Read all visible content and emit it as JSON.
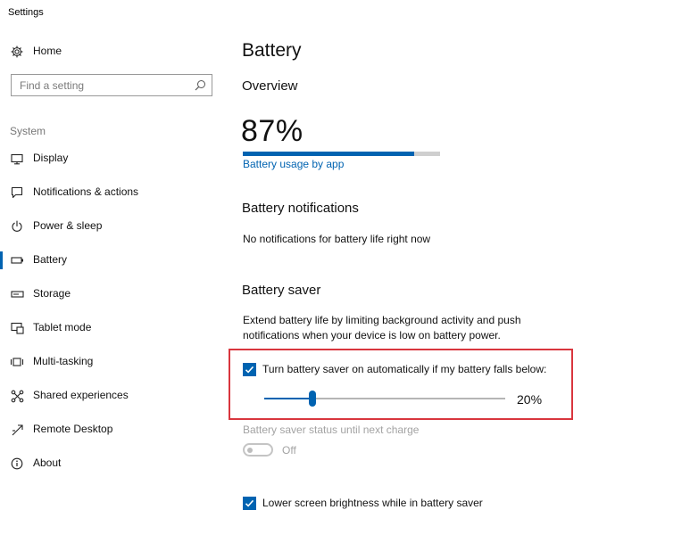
{
  "window": {
    "title": "Settings"
  },
  "sidebar": {
    "home_label": "Home",
    "search_placeholder": "Find a setting",
    "section_label": "System",
    "items": [
      {
        "label": "Display",
        "icon": "monitor-icon",
        "active": false
      },
      {
        "label": "Notifications & actions",
        "icon": "notification-icon",
        "active": false
      },
      {
        "label": "Power & sleep",
        "icon": "power-icon",
        "active": false
      },
      {
        "label": "Battery",
        "icon": "battery-icon",
        "active": true
      },
      {
        "label": "Storage",
        "icon": "storage-icon",
        "active": false
      },
      {
        "label": "Tablet mode",
        "icon": "tablet-mode-icon",
        "active": false
      },
      {
        "label": "Multi-tasking",
        "icon": "multitasking-icon",
        "active": false
      },
      {
        "label": "Shared experiences",
        "icon": "shared-experiences-icon",
        "active": false
      },
      {
        "label": "Remote Desktop",
        "icon": "remote-desktop-icon",
        "active": false
      },
      {
        "label": "About",
        "icon": "info-icon",
        "active": false
      }
    ]
  },
  "main": {
    "page_title": "Battery",
    "overview": {
      "heading": "Overview",
      "percent_text": "87%",
      "percent_value": 0.87,
      "usage_link": "Battery usage by app"
    },
    "notifications": {
      "heading": "Battery notifications",
      "text": "No notifications for battery life right now"
    },
    "saver": {
      "heading": "Battery saver",
      "description": "Extend battery life by limiting background activity and push notifications when your device is low on battery power.",
      "auto_checkbox_label": "Turn battery saver on automatically if my battery falls below:",
      "auto_checked": true,
      "threshold_text": "20%",
      "threshold_value": 0.2,
      "status_label": "Battery saver status until next charge",
      "toggle_state": "Off",
      "lower_brightness_label": "Lower screen brightness while in battery saver",
      "lower_brightness_checked": true
    }
  },
  "colors": {
    "accent": "#0063b1",
    "highlight_border": "#d9363e",
    "disabled_text": "#a3a3a3"
  }
}
